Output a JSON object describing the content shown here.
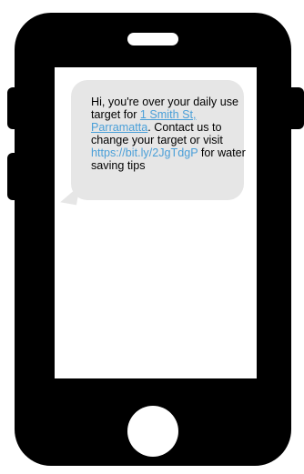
{
  "sms": {
    "text_before_address": "Hi, you're over your daily use target for ",
    "address_link": "1 Smith St, Parramatta",
    "text_after_address": ". Contact us to change your target or visit ",
    "url_link": "https://bit.ly/2JgTdgP",
    "text_end": " for water saving tips"
  },
  "colors": {
    "phone": "#000000",
    "bubble": "#e6e6e6",
    "link": "#4a9fd8"
  }
}
